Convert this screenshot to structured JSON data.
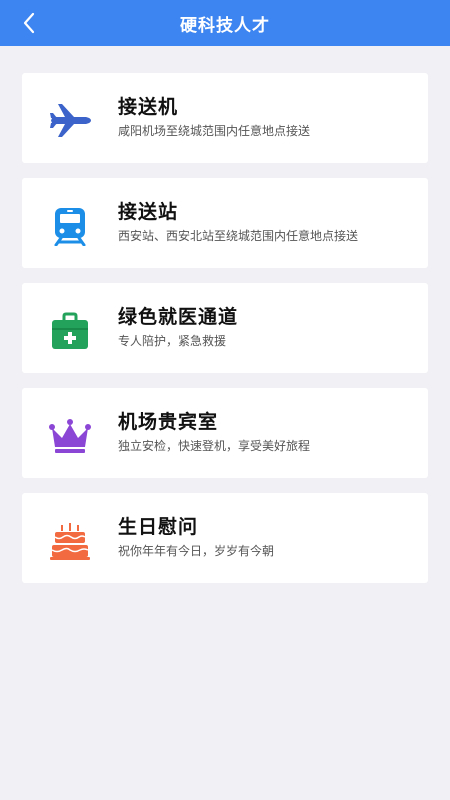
{
  "header": {
    "title": "硬科技人才",
    "back_icon": "chevron-left-icon"
  },
  "colors": {
    "header_bg": "#3d85f0",
    "page_bg": "#f1f0f5",
    "plane": "#3b63c9",
    "train": "#1c8ee8",
    "medkit": "#22a25a",
    "crown": "#8b46d6",
    "cake": "#f26a3f"
  },
  "services": [
    {
      "icon": "airplane-icon",
      "title": "接送机",
      "subtitle": "咸阳机场至绕城范围内任意地点接送"
    },
    {
      "icon": "train-icon",
      "title": "接送站",
      "subtitle": "西安站、西安北站至绕城范围内任意地点接送"
    },
    {
      "icon": "medical-kit-icon",
      "title": "绿色就医通道",
      "subtitle": "专人陪护，紧急救援"
    },
    {
      "icon": "crown-icon",
      "title": "机场贵宾室",
      "subtitle": "独立安检，快速登机，享受美好旅程"
    },
    {
      "icon": "birthday-cake-icon",
      "title": "生日慰问",
      "subtitle": "祝你年年有今日，岁岁有今朝"
    }
  ]
}
